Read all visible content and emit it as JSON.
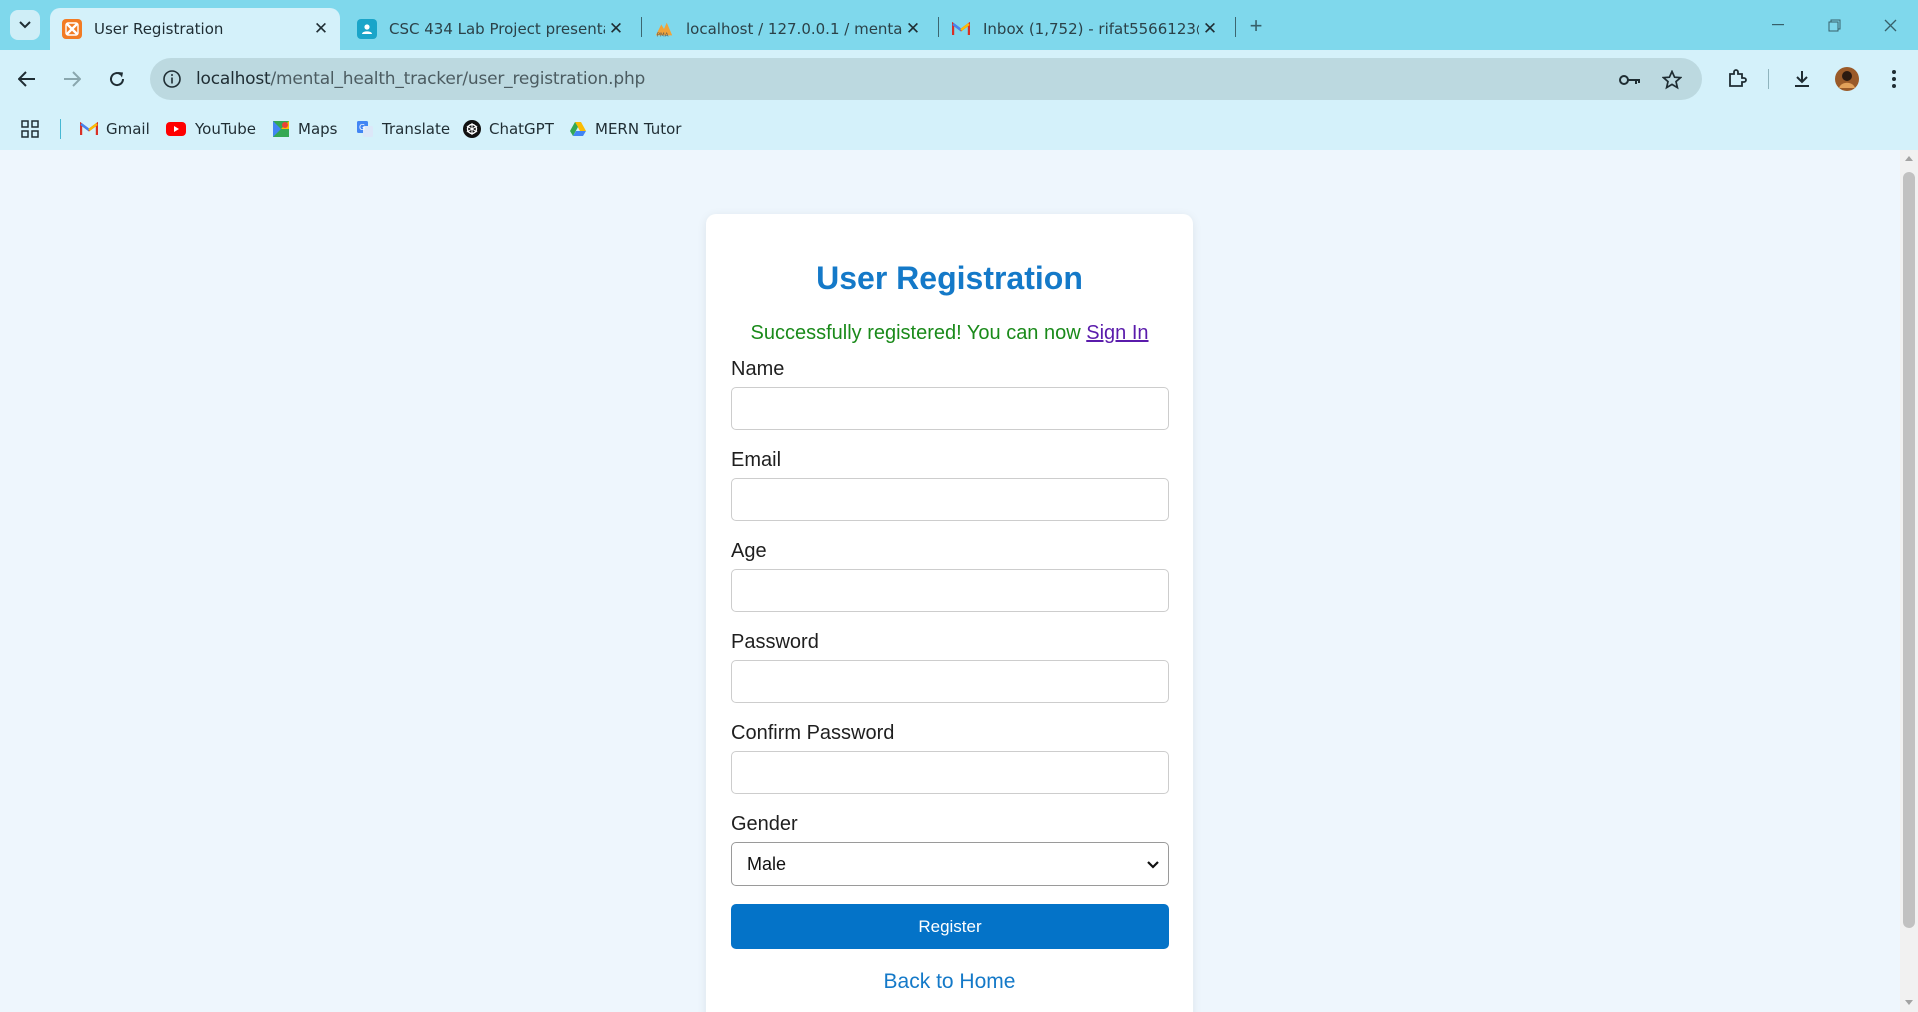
{
  "browser": {
    "tabs": [
      {
        "title": "User Registration",
        "active": true
      },
      {
        "title": "CSC 434 Lab Project presentatio",
        "active": false
      },
      {
        "title": "localhost / 127.0.0.1 / mental_h",
        "active": false
      },
      {
        "title": "Inbox (1,752) - rifat5566123@gm",
        "active": false
      }
    ],
    "address": {
      "host": "localhost",
      "path": "/mental_health_tracker/user_registration.php"
    },
    "bookmarks": [
      {
        "label": "Gmail",
        "icon": "gmail-icon"
      },
      {
        "label": "YouTube",
        "icon": "youtube-icon"
      },
      {
        "label": "Maps",
        "icon": "maps-icon"
      },
      {
        "label": "Translate",
        "icon": "translate-icon"
      },
      {
        "label": "ChatGPT",
        "icon": "chatgpt-icon"
      },
      {
        "label": "MERN Tutor",
        "icon": "drive-icon"
      }
    ]
  },
  "page": {
    "title": "User Registration",
    "success_message": "Successfully registered! You can now",
    "signin_link": "Sign In",
    "fields": {
      "name_label": "Name",
      "email_label": "Email",
      "age_label": "Age",
      "password_label": "Password",
      "confirm_label": "Confirm Password",
      "gender_label": "Gender",
      "gender_value": "Male"
    },
    "register_button": "Register",
    "back_link": "Back to Home"
  },
  "colors": {
    "tab_bar": "#7fd8ec",
    "toolbar": "#d4f1fa",
    "heading": "#1479c8",
    "success": "#1a8a1a",
    "button": "#0473c8",
    "page_bg": "#eef6fd"
  }
}
